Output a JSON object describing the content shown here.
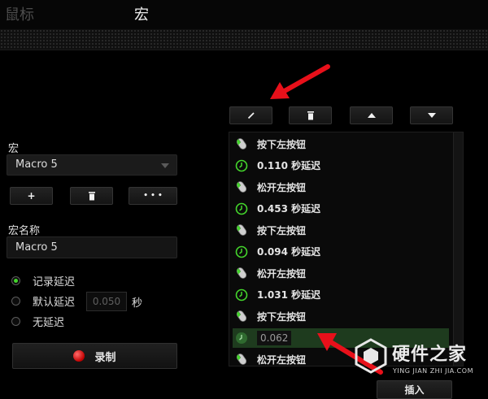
{
  "header": {
    "tab_mouse": "鼠标",
    "tab_macro": "宏"
  },
  "left": {
    "macro_label": "宏",
    "macro_select_value": "Macro 5",
    "add_label": "+",
    "more_label": "• • •",
    "macro_name_label": "宏名称",
    "macro_name_value": "Macro 5",
    "delay_options": [
      {
        "label": "记录延迟",
        "selected": true
      },
      {
        "label": "默认延迟",
        "selected": false
      },
      {
        "label": "无延迟",
        "selected": false
      }
    ],
    "default_delay_value": "0.050",
    "delay_unit": "秒",
    "record_label": "录制"
  },
  "list": {
    "items": [
      {
        "icon": "mouse-icon",
        "text": "按下左按钮"
      },
      {
        "icon": "clock-icon",
        "text": "0.110 秒延迟"
      },
      {
        "icon": "mouse-icon",
        "text": "松开左按钮"
      },
      {
        "icon": "clock-icon",
        "text": "0.453 秒延迟"
      },
      {
        "icon": "mouse-icon",
        "text": "按下左按钮"
      },
      {
        "icon": "clock-icon",
        "text": "0.094 秒延迟"
      },
      {
        "icon": "mouse-icon",
        "text": "松开左按钮"
      },
      {
        "icon": "clock-icon",
        "text": "1.031 秒延迟"
      },
      {
        "icon": "mouse-icon",
        "text": "按下左按钮"
      },
      {
        "icon": "clock-icon",
        "text": "0.062",
        "editing": true
      },
      {
        "icon": "mouse-icon",
        "text": "松开左按钮"
      }
    ],
    "insert_label": "插入"
  },
  "colors": {
    "accent_green": "#44d62c",
    "annotation_red": "#e8101a",
    "record_red": "#d40000"
  },
  "watermark": {
    "title": "硬件之家",
    "subtitle": "YING JIAN ZHI JIA.COM"
  }
}
